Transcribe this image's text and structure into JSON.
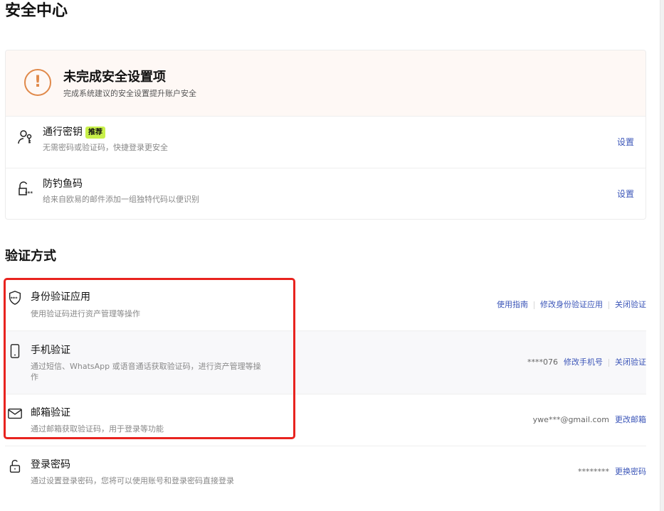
{
  "page": {
    "title": "安全中心"
  },
  "security_card": {
    "warning_title": "未完成安全设置项",
    "warning_subtitle": "完成系统建议的安全设置提升账户安全",
    "items": [
      {
        "title": "通行密钥",
        "badge": "推荐",
        "subtitle": "无需密码或验证码，快捷登录更安全",
        "action": "设置",
        "icon": "passkey-icon"
      },
      {
        "title": "防钓鱼码",
        "subtitle": "给来自欧易的邮件添加一组独特代码以便识别",
        "action": "设置",
        "icon": "anti-phishing-icon"
      }
    ]
  },
  "verification": {
    "title": "验证方式",
    "methods": [
      {
        "title": "身份验证应用",
        "subtitle": "使用验证码进行资产管理等操作",
        "icon": "shield-icon",
        "actions": [
          "使用指南",
          "修改身份验证应用",
          "关闭验证"
        ]
      },
      {
        "title": "手机验证",
        "subtitle": "通过短信、WhatsApp 或语音通话获取验证码，进行资产管理等操作",
        "masked": "****076",
        "icon": "phone-icon",
        "actions": [
          "修改手机号",
          "关闭验证"
        ]
      },
      {
        "title": "邮箱验证",
        "subtitle": "通过邮箱获取验证码，用于登录等功能",
        "masked": "ywe***@gmail.com",
        "icon": "mail-icon",
        "actions": [
          "更改邮箱"
        ]
      },
      {
        "title": "登录密码",
        "subtitle": "通过设置登录密码，您将可以使用账号和登录密码直接登录",
        "masked": "********",
        "icon": "lock-icon",
        "actions": [
          "更换密码"
        ]
      }
    ]
  },
  "colors": {
    "accent_link": "#3b55b8",
    "warning": "#e0894a",
    "badge": "#c8f04a",
    "highlight": "#e8231f"
  }
}
